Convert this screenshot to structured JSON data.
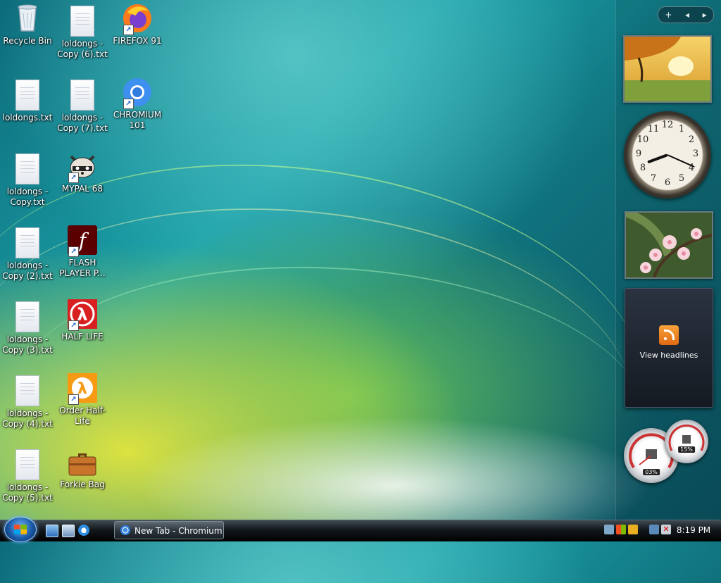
{
  "desktop": {
    "icons": [
      {
        "label": "Recycle Bin"
      },
      {
        "label": "loldongs - Copy (6).txt"
      },
      {
        "label": "FIREFOX 91"
      },
      {
        "label": "loldongs.txt"
      },
      {
        "label": "loldongs - Copy (7).txt"
      },
      {
        "label": "CHROMIUM 101"
      },
      {
        "label": "loldongs - Copy.txt"
      },
      {
        "label": "MYPAL 68"
      },
      {
        "label": "loldongs - Copy (2).txt"
      },
      {
        "label": "FLASH PLAYER P..."
      },
      {
        "label": "loldongs - Copy (3).txt"
      },
      {
        "label": "HALF LIFE"
      },
      {
        "label": "loldongs - Copy (4).txt"
      },
      {
        "label": "Order Half-Life"
      },
      {
        "label": "loldongs - Copy (5).txt"
      },
      {
        "label": "Forkie Bag"
      }
    ]
  },
  "sidebar": {
    "controls": {
      "add": "+",
      "prev": "◂",
      "next": "▸"
    },
    "clock_numbers": [
      "12",
      "1",
      "2",
      "3",
      "4",
      "5",
      "6",
      "7",
      "8",
      "9",
      "10",
      "11"
    ],
    "clock_time": "8:19",
    "feed_label": "View headlines",
    "cpu_percent": "03%",
    "memory_percent": "15%"
  },
  "taskbar": {
    "task_label": "New Tab - Chromium",
    "clock": "8:19 PM"
  },
  "colors": {
    "accent": "#1c5bc4",
    "rss": "#f08a24",
    "half_life": "#d92020",
    "flash": "#5a0000"
  }
}
